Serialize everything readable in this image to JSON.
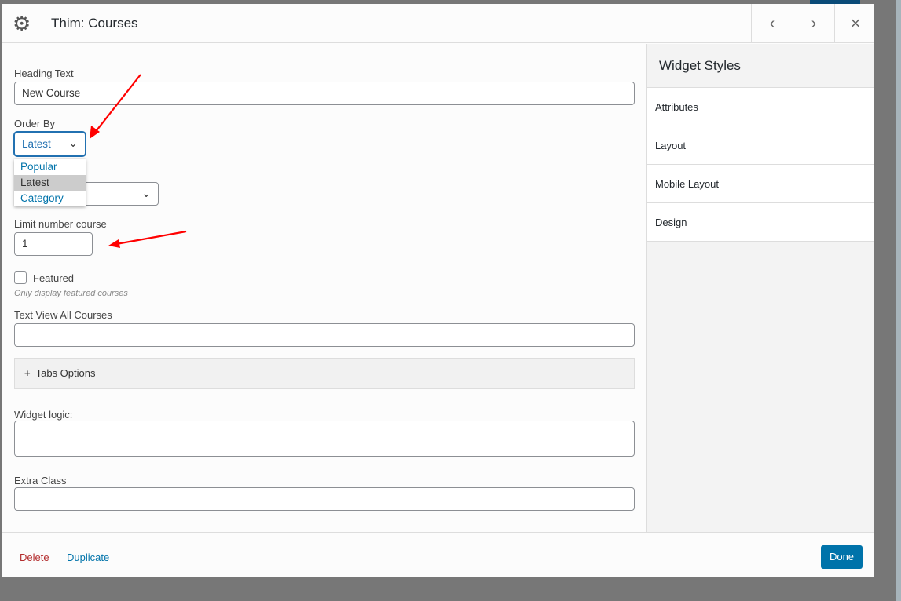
{
  "modal": {
    "title": "Thim: Courses",
    "icon": "gear-icon"
  },
  "header_buttons": {
    "prev": "‹",
    "next": "›",
    "close": "×"
  },
  "form": {
    "heading_label": "Heading Text",
    "heading_value": "New Course",
    "order_label": "Order By",
    "order_value": "Latest",
    "order_options": [
      "Popular",
      "Latest",
      "Category"
    ],
    "limit_label": "Limit number course",
    "limit_value": "1",
    "featured_label": "Featured",
    "featured_help": "Only display featured courses",
    "view_all_label": "Text View All Courses",
    "view_all_value": "",
    "tabs_options": "Tabs Options",
    "logic_label": "Widget logic:",
    "logic_value": "",
    "extra_label": "Extra Class",
    "extra_value": ""
  },
  "sidebar": {
    "title": "Widget Styles",
    "items": [
      "Attributes",
      "Layout",
      "Mobile Layout",
      "Design"
    ]
  },
  "footer": {
    "delete": "Delete",
    "duplicate": "Duplicate",
    "done": "Done"
  },
  "colors": {
    "accent": "#0073aa",
    "delete": "#b32d2e",
    "annotation": "#ff0000"
  }
}
